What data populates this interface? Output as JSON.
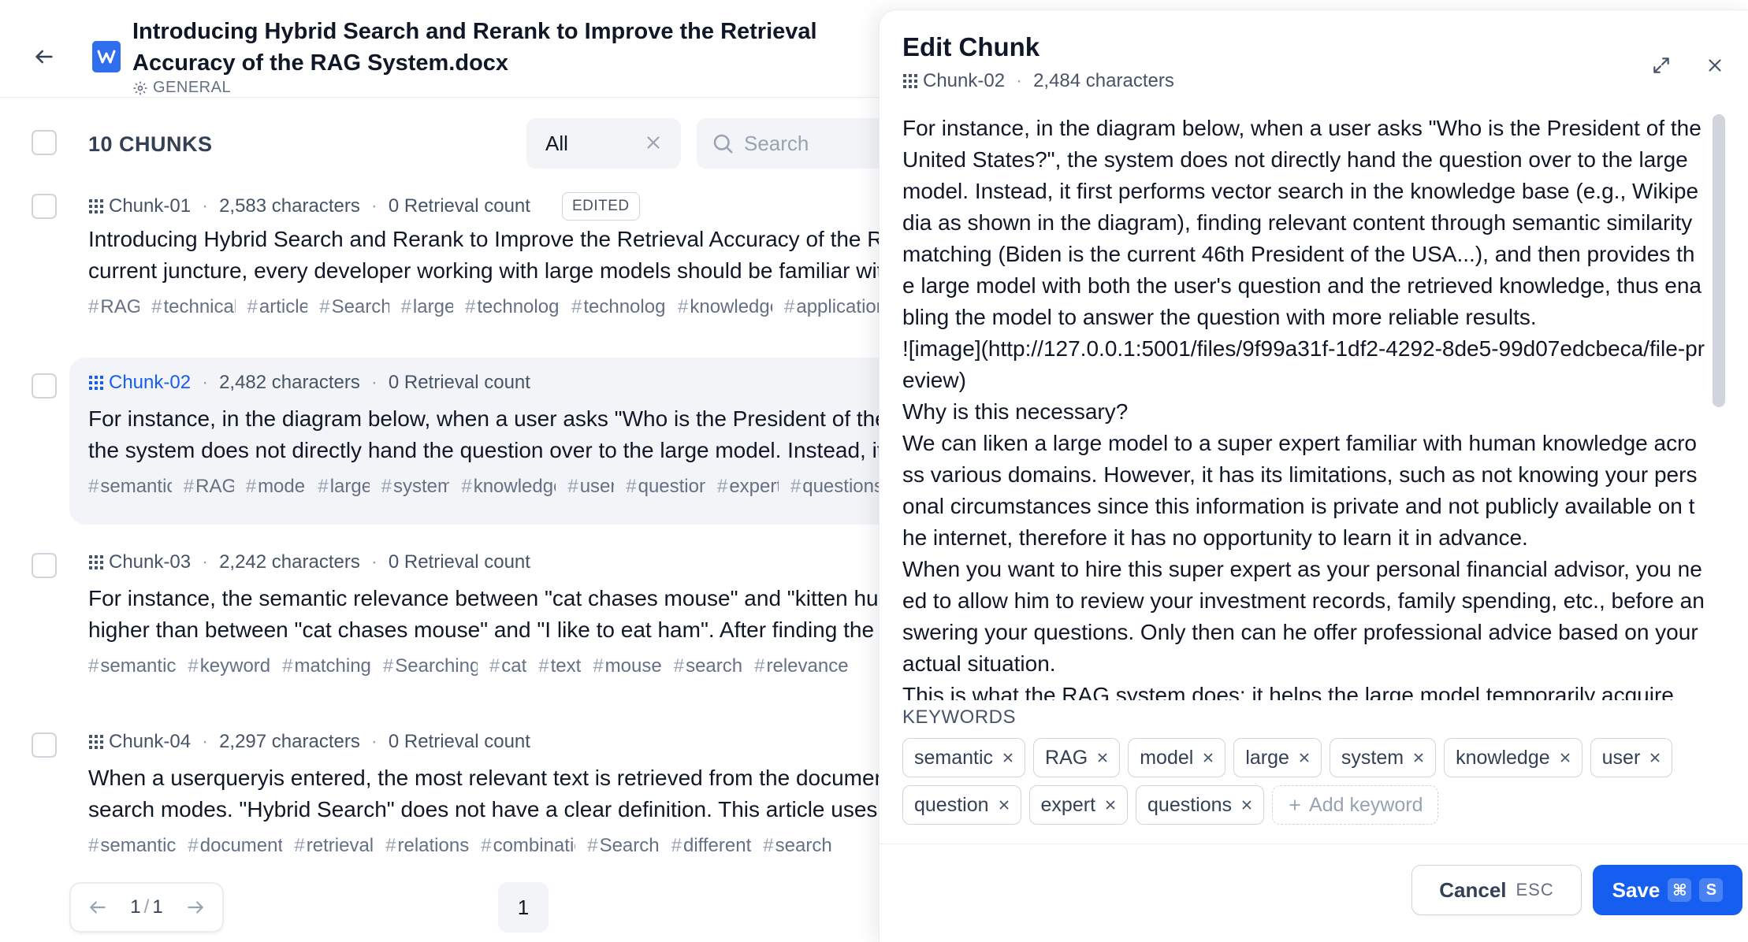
{
  "document": {
    "title": "Introducing Hybrid Search and Rerank to Improve the Retrieval Accuracy of the RAG System.docx",
    "mode": "GENERAL",
    "icon": "word-doc-icon",
    "brand_color": "#2f6fed"
  },
  "toolbar": {
    "chunk_count": "10 CHUNKS",
    "filter_value": "All",
    "search_placeholder": "Search"
  },
  "chunks": [
    {
      "name": "Chunk-01",
      "characters": "2,583 characters",
      "retrieval": "0 Retrieval count",
      "badge": "EDITED",
      "line1": "Introducing Hybrid Search and Rerank to Improve the Retrieval Accuracy of the RAG System. At the",
      "line2": "current juncture, every developer working with large models should be familiar with RAG...",
      "tags": [
        "RAG",
        "technical",
        "article",
        "Search",
        "large",
        "technology",
        "technology",
        "knowledge",
        "application"
      ]
    },
    {
      "name": "Chunk-02",
      "characters": "2,482 characters",
      "retrieval": "0 Retrieval count",
      "line1": "For instance, in the diagram below, when a user asks \"Who is the President of the United States?\",",
      "line2": "the system does not directly hand the question over to the large model. Instead, it first performs",
      "tags": [
        "semantic",
        "RAG",
        "model",
        "large",
        "system",
        "knowledge",
        "user",
        "question",
        "expert",
        "questions"
      ]
    },
    {
      "name": "Chunk-03",
      "characters": "2,242 characters",
      "retrieval": "0 Retrieval count",
      "line1": "For instance, the semantic relevance between \"cat chases mouse\" and \"kitten hunting mouse\" is",
      "line2": "higher than between \"cat chases mouse\" and \"I like to eat ham\". After finding the most relevant",
      "tags": [
        "semantic",
        "keyword",
        "matching",
        "Searching",
        "cat",
        "text",
        "mouse",
        "search",
        "relevance"
      ]
    },
    {
      "name": "Chunk-04",
      "characters": "2,297 characters",
      "retrieval": "0 Retrieval count",
      "line1": "When a userqueryis entered, the most relevant text is retrieved from the document through different",
      "line2": "search modes. \"Hybrid Search\" does not have a clear definition. This article uses the combination",
      "tags": [
        "semantic",
        "document",
        "retrieval",
        "relations",
        "combination",
        "Search",
        "different",
        "search"
      ]
    }
  ],
  "pagination": {
    "current": "1",
    "separator": "/",
    "total": "1",
    "page_button": "1"
  },
  "edit_panel": {
    "title": "Edit Chunk",
    "chunk_name": "Chunk-02",
    "characters": "2,484 characters",
    "content": "For instance, in the diagram below, when a user asks \"Who is the President of the United States?\", the system does not directly hand the question over to the large model. Instead, it first performs vector search in the knowledge base (e.g., Wikipedia as shown in the diagram), finding relevant content through semantic similarity matching (Biden is the current 46th President of the USA...), and then provides the large model with both the user's question and the retrieved knowledge, thus enabling the model to answer the question with more reliable results.\n![image](http://127.0.0.1:5001/files/9f99a31f-1df2-4292-8de5-99d07edcbeca/file-preview)\nWhy is this necessary?\nWe can liken a large model to a super expert familiar with human knowledge across various domains. However, it has its limitations, such as not knowing your personal circumstances since this information is private and not publicly available on the internet, therefore it has no opportunity to learn it in advance.\nWhen you want to hire this super expert as your personal financial advisor, you need to allow him to review your investment records, family spending, etc., before answering your questions. Only then can he offer professional advice based on your actual situation.\nThis is what the RAG system does: it helps the large model temporarily acquire",
    "keywords_label": "KEYWORDS",
    "keywords": [
      "semantic",
      "RAG",
      "model",
      "large",
      "system",
      "knowledge",
      "user",
      "question",
      "expert",
      "questions"
    ],
    "add_keyword": "Add keyword",
    "cancel_label": "Cancel",
    "cancel_shortcut": "ESC",
    "save_label": "Save",
    "save_shortcut_mod": "⌘",
    "save_shortcut_key": "S",
    "accent_color": "#155eef"
  }
}
